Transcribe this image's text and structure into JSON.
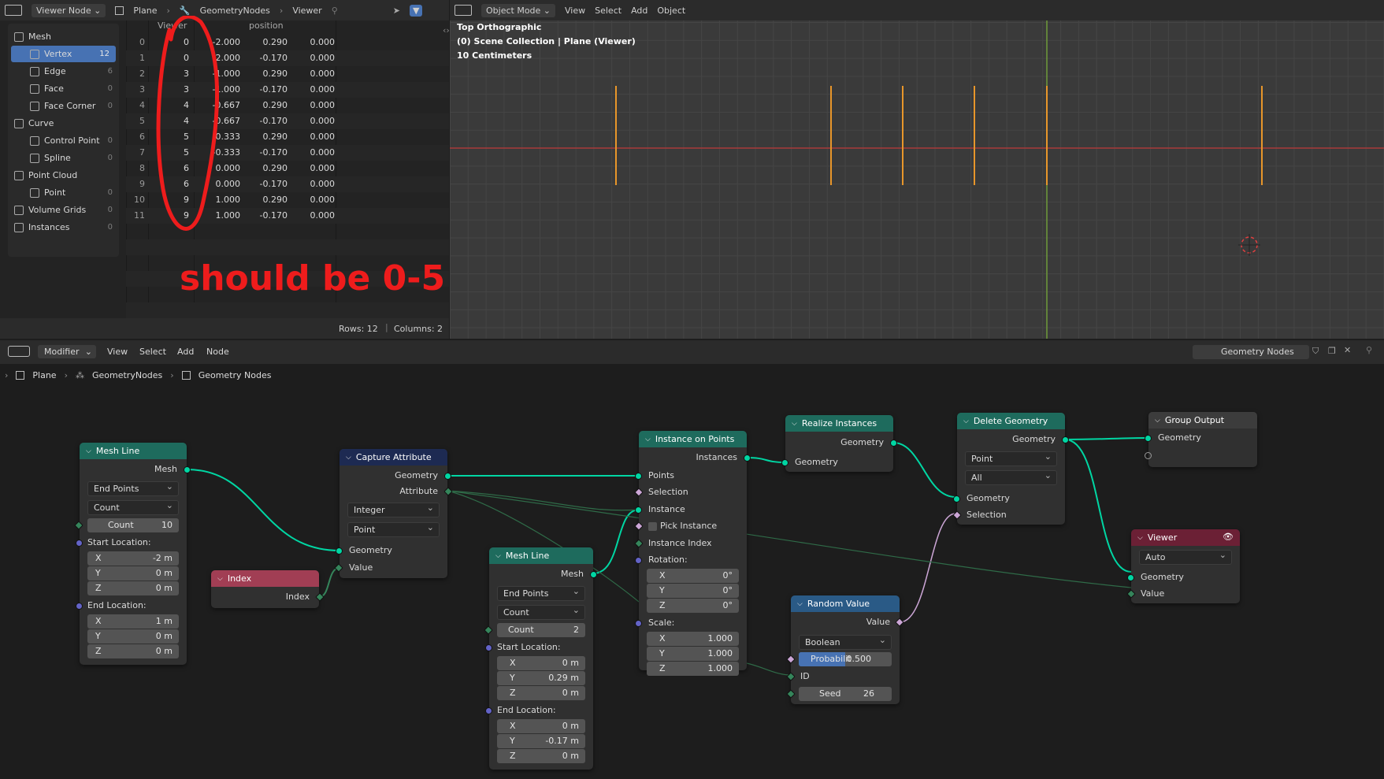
{
  "top_header_left": {
    "editor_type": "Viewer Node",
    "breadcrumb": [
      "Plane",
      "GeometryNodes",
      "Viewer"
    ]
  },
  "top_header_right": {
    "mode": "Object Mode",
    "menus": [
      "View",
      "Select",
      "Add",
      "Object"
    ]
  },
  "tree": [
    {
      "label": "Mesh",
      "count": "",
      "level": 0,
      "icon": "mesh-icon"
    },
    {
      "label": "Vertex",
      "count": "12",
      "level": 1,
      "icon": "vertex-icon",
      "active": true
    },
    {
      "label": "Edge",
      "count": "6",
      "level": 1,
      "icon": "edge-icon"
    },
    {
      "label": "Face",
      "count": "0",
      "level": 1,
      "icon": "face-icon"
    },
    {
      "label": "Face Corner",
      "count": "0",
      "level": 1,
      "icon": "face-corner-icon"
    },
    {
      "label": "Curve",
      "count": "",
      "level": 0,
      "icon": "curve-icon"
    },
    {
      "label": "Control Point",
      "count": "0",
      "level": 1,
      "icon": "control-point-icon"
    },
    {
      "label": "Spline",
      "count": "0",
      "level": 1,
      "icon": "spline-icon"
    },
    {
      "label": "Point Cloud",
      "count": "",
      "level": 0,
      "icon": "point-cloud-icon"
    },
    {
      "label": "Point",
      "count": "0",
      "level": 1,
      "icon": "point-icon"
    },
    {
      "label": "Volume Grids",
      "count": "0",
      "level": 0,
      "icon": "volume-icon"
    },
    {
      "label": "Instances",
      "count": "0",
      "level": 0,
      "icon": "instances-icon"
    }
  ],
  "spreadsheet": {
    "columns": [
      "Viewer",
      "position"
    ],
    "rows": [
      [
        "0",
        "0",
        "-2.000",
        "0.290",
        "0.000"
      ],
      [
        "1",
        "0",
        "-2.000",
        "-0.170",
        "0.000"
      ],
      [
        "2",
        "3",
        "-1.000",
        "0.290",
        "0.000"
      ],
      [
        "3",
        "3",
        "-1.000",
        "-0.170",
        "0.000"
      ],
      [
        "4",
        "4",
        "-0.667",
        "0.290",
        "0.000"
      ],
      [
        "5",
        "4",
        "-0.667",
        "-0.170",
        "0.000"
      ],
      [
        "6",
        "5",
        "-0.333",
        "0.290",
        "0.000"
      ],
      [
        "7",
        "5",
        "-0.333",
        "-0.170",
        "0.000"
      ],
      [
        "8",
        "6",
        "0.000",
        "0.290",
        "0.000"
      ],
      [
        "9",
        "6",
        "0.000",
        "-0.170",
        "0.000"
      ],
      [
        "10",
        "9",
        "1.000",
        "0.290",
        "0.000"
      ],
      [
        "11",
        "9",
        "1.000",
        "-0.170",
        "0.000"
      ]
    ],
    "footer_rows": "Rows: 12",
    "footer_cols": "Columns: 2"
  },
  "annotation": "should be 0-5",
  "viewport": {
    "line1": "Top Orthographic",
    "line2": "(0) Scene Collection | Plane (Viewer)",
    "line3": "10 Centimeters"
  },
  "node_header": {
    "modifier": "Modifier",
    "menus": [
      "View",
      "Select",
      "Add",
      "Node"
    ],
    "tree_name": "Geometry Nodes"
  },
  "node_breadcrumb": [
    "Plane",
    "GeometryNodes",
    "Geometry Nodes"
  ],
  "nodes": {
    "mesh_line1": {
      "title": "Mesh Line",
      "out": "Mesh",
      "mode": "End Points",
      "count_mode": "Count",
      "count_label": "Count",
      "count": "10",
      "start": "Start Location:",
      "sx": "-2 m",
      "sy": "0 m",
      "sz": "0 m",
      "end": "End Location:",
      "ex": "1 m",
      "ey": "0 m",
      "ez": "0 m"
    },
    "index": {
      "title": "Index",
      "out": "Index"
    },
    "capture": {
      "title": "Capture Attribute",
      "out_geo": "Geometry",
      "out_attr": "Attribute",
      "type": "Integer",
      "domain": "Point",
      "in_geo": "Geometry",
      "in_val": "Value"
    },
    "mesh_line2": {
      "title": "Mesh Line",
      "out": "Mesh",
      "mode": "End Points",
      "count_mode": "Count",
      "count_label": "Count",
      "count": "2",
      "start": "Start Location:",
      "sx": "0 m",
      "sy": "0.29 m",
      "sz": "0 m",
      "end": "End Location:",
      "ex": "0 m",
      "ey": "-0.17 m",
      "ez": "0 m"
    },
    "iop": {
      "title": "Instance on Points",
      "out": "Instances",
      "points": "Points",
      "selection": "Selection",
      "instance": "Instance",
      "pick": "Pick Instance",
      "inst_index": "Instance Index",
      "rotation": "Rotation:",
      "rx": "0°",
      "ry": "0°",
      "rz": "0°",
      "scale": "Scale:",
      "scx": "1.000",
      "scy": "1.000",
      "scz": "1.000"
    },
    "realize": {
      "title": "Realize Instances",
      "out": "Geometry",
      "in": "Geometry"
    },
    "random": {
      "title": "Random Value",
      "out": "Value",
      "type": "Boolean",
      "prob_label": "Probabilit",
      "prob": "0.500",
      "id": "ID",
      "seed_label": "Seed",
      "seed": "26"
    },
    "delete": {
      "title": "Delete Geometry",
      "out": "Geometry",
      "domain": "Point",
      "mode": "All",
      "in_geo": "Geometry",
      "in_sel": "Selection"
    },
    "group_output": {
      "title": "Group Output",
      "in": "Geometry"
    },
    "viewer": {
      "title": "Viewer",
      "domain": "Auto",
      "geo": "Geometry",
      "val": "Value"
    }
  },
  "labels": {
    "x": "X",
    "y": "Y",
    "z": "Z"
  }
}
